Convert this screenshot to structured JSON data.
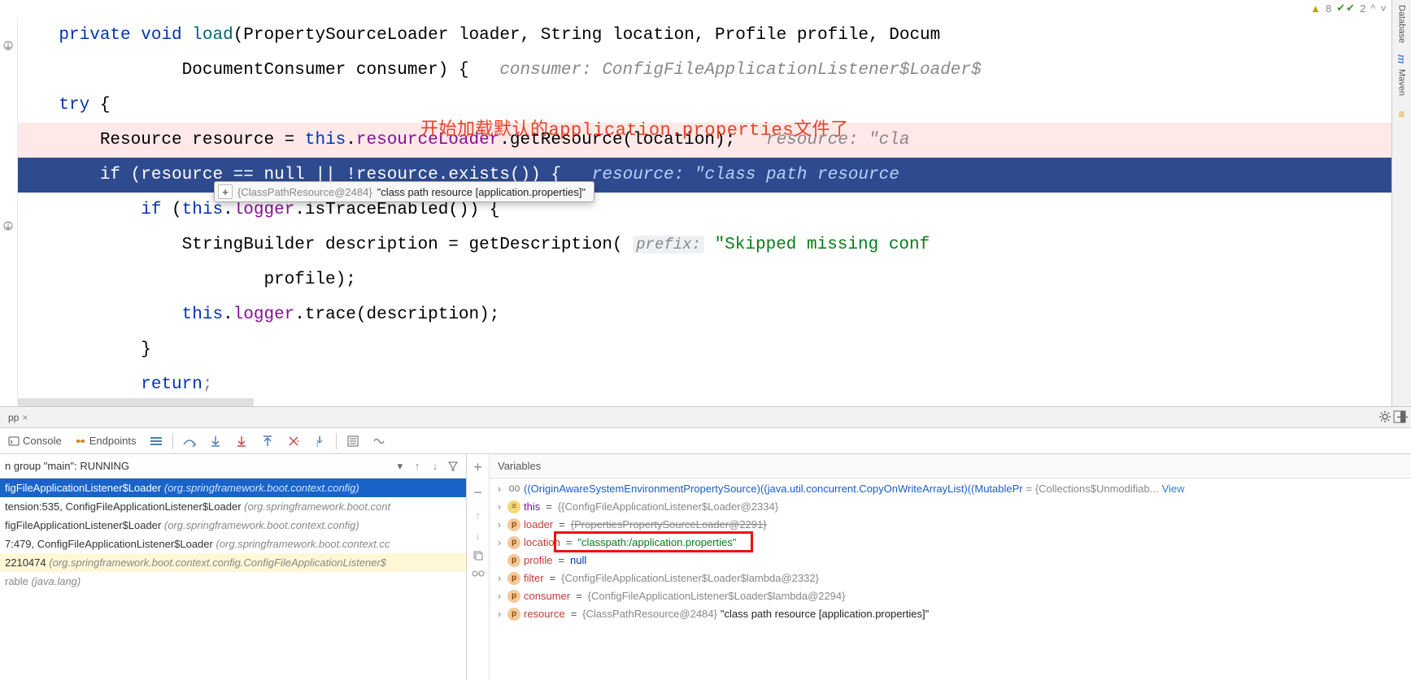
{
  "top_status": {
    "warnings": "8",
    "checks": "2",
    "nav": {
      "up": "^",
      "down": "˅"
    }
  },
  "right_sidebar": {
    "tab_database": "Database",
    "tab_maven": "Maven"
  },
  "editor": {
    "annotation": "开始加载默认的application.properties文件了",
    "lines": {
      "l1_kw_private": "private",
      "l1_kw_void": "void",
      "l1_method": "load",
      "l1_rest": "(PropertySourceLoader loader, String location, Profile profile, Docum",
      "l2": "                DocumentConsumer consumer) {",
      "l2_hint": "consumer: ConfigFileApplicationListener$Loader$",
      "l3": "    try {",
      "l4a": "        Resource resource = ",
      "l4_kw_this": "this",
      "l4b": ".",
      "l4_field": "resourceLoader",
      "l4c": ".getResource(location);",
      "l4_hint": "resource: \"cla",
      "l5a": "        if (resource == null || !resource.exists()) {",
      "l5_hint": "resource: \"class path resource",
      "l6": "            if (this.logger.isTraceEnabled()) {",
      "l6_kw_if": "if",
      "l6_kw_this": "this",
      "l6_field": "logger",
      "l6_rest": ".isTraceEnabled()) {",
      "l7a": "                StringBuilder description = getDescription(",
      "l7_param": "prefix:",
      "l7_str": "\"Skipped missing conf",
      "l8": "                        profile);",
      "l9a": "                ",
      "l9_kw_this": "this",
      "l9_field": "logger",
      "l9_rest": ".trace(description);",
      "l10": "            }",
      "l11": "            return;"
    },
    "tooltip": {
      "type": "{ClassPathResource@2484}",
      "value": "\"class path resource [application.properties]\""
    }
  },
  "debug": {
    "tab_label": "pp",
    "toolbar": {
      "console": "Console",
      "endpoints": "Endpoints"
    },
    "frames": {
      "thread": "n group \"main\": RUNNING",
      "rows": [
        {
          "main": "figFileApplicationListener$Loader",
          "pkg": "(org.springframework.boot.context.config)",
          "selected": true
        },
        {
          "main": "tension:535, ConfigFileApplicationListener$Loader",
          "pkg": "(org.springframework.boot.cont",
          "selected": false
        },
        {
          "main": "figFileApplicationListener$Loader",
          "pkg": "(org.springframework.boot.context.config)",
          "selected": false
        },
        {
          "main": "7:479, ConfigFileApplicationListener$Loader",
          "pkg": "(org.springframework.boot.context.cc",
          "selected": false
        },
        {
          "main": "2210474",
          "pkg": "(org.springframework.boot.context.config.ConfigFileApplicationListener$",
          "selected": false,
          "highlight": true
        },
        {
          "main": "rable",
          "pkg": "(java.lang)",
          "selected": false
        }
      ]
    },
    "variables": {
      "header": "Variables",
      "rows": [
        {
          "kind": "oo",
          "text": "((OriginAwareSystemEnvironmentPropertySource)((java.util.concurrent.CopyOnWriteArrayList)((MutablePr",
          "val": "= {Collections$Unmodifiab...",
          "viewlink": "View"
        },
        {
          "kind": "f",
          "name": "this",
          "val_gray": "{ConfigFileApplicationListener$Loader@2334}"
        },
        {
          "kind": "p",
          "name": "loader",
          "val_gray": "{PropertiesPropertySourceLoader@2291}",
          "strike": true
        },
        {
          "kind": "p",
          "name": "location",
          "val_str": "\"classpath:/application.properties\"",
          "boxed": true
        },
        {
          "kind": "p",
          "name": "profile",
          "val_raw": "null",
          "no_arrow": true
        },
        {
          "kind": "p",
          "name": "filter",
          "val_gray": "{ConfigFileApplicationListener$Loader$lambda@2332}"
        },
        {
          "kind": "p",
          "name": "consumer",
          "val_gray": "{ConfigFileApplicationListener$Loader$lambda@2294}"
        },
        {
          "kind": "p",
          "name": "resource",
          "val_gray": "{ClassPathResource@2484}",
          "val_extra": "\"class path resource [application.properties]\""
        }
      ]
    }
  }
}
